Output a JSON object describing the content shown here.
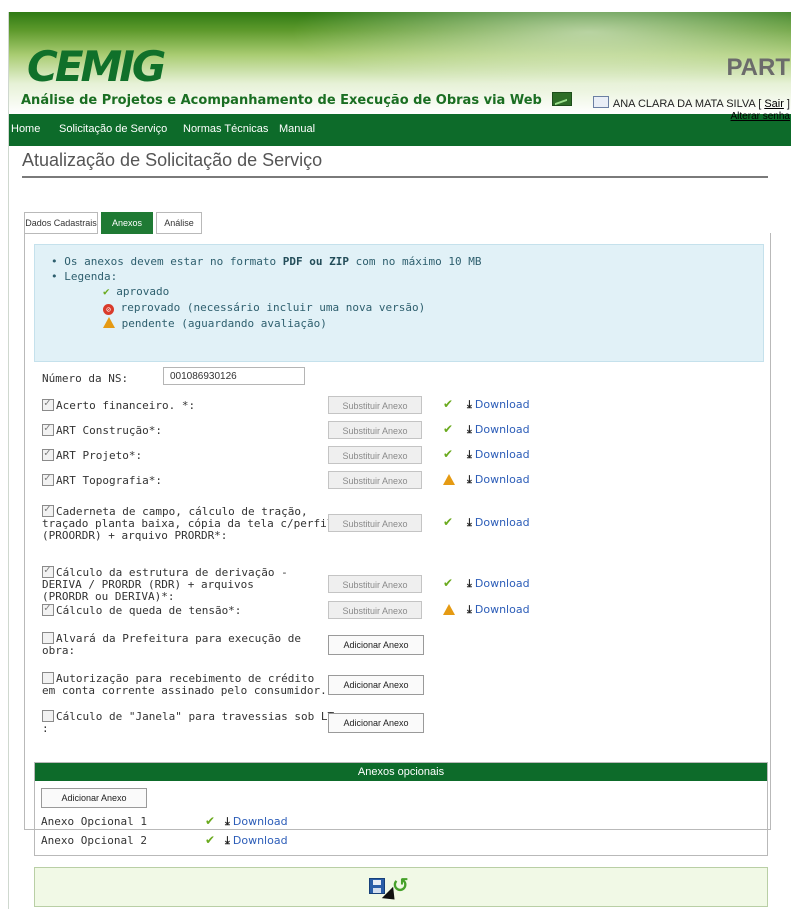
{
  "header": {
    "logo": "CEMIG",
    "subtitle": "Análise de Projetos e Acompanhamento de Execução de Obras via Web",
    "app_code": "PART",
    "user_name": "ANA CLARA DA MATA SILVA",
    "logout_label": "Sair",
    "change_password_label": "Alterar senha"
  },
  "nav": [
    "Home",
    "Solicitação de Serviço",
    "Normas Técnicas",
    "Manual"
  ],
  "page_title": "Atualização de Solicitação de Serviço",
  "tabs": [
    "Dados Cadastrais",
    "Anexos",
    "Análise"
  ],
  "active_tab": "Anexos",
  "info": {
    "line1_prefix": "Os anexos devem estar no formato",
    "line1_format": "PDF ou ZIP",
    "line1_suffix": "com no máximo 10 MB",
    "legend_label": "Legenda:",
    "approved": "aprovado",
    "rejected": "reprovado (necessário incluir uma nova versão)",
    "pending": "pendente (aguardando avaliação)"
  },
  "ns": {
    "label": "Número da NS:",
    "value": "001086930126"
  },
  "buttons": {
    "replace": "Substituir Anexo",
    "add": "Adicionar Anexo"
  },
  "download_label": "Download",
  "attachments": [
    {
      "label": "Acerto financeiro. *:",
      "checked": true,
      "status": "approved"
    },
    {
      "label": "ART Construção*:",
      "checked": true,
      "status": "approved"
    },
    {
      "label": "ART Projeto*:",
      "checked": true,
      "status": "approved"
    },
    {
      "label": "ART Topografia*:",
      "checked": true,
      "status": "pending"
    },
    {
      "label_lines": [
        "Caderneta de campo, cálculo de tração,",
        "traçado planta baixa, cópia da tela c/perfil",
        "(PROORDR) + arquivo PRORDR*:"
      ],
      "checked": true,
      "status": "approved"
    },
    {
      "label_lines": [
        "Cálculo da estrutura de derivação -",
        "DERIVA / PRORDR (RDR) + arquivos",
        "(PRORDR ou DERIVA)*:"
      ],
      "checked": true,
      "status": "approved"
    },
    {
      "label": "Cálculo de queda de tensão*:",
      "checked": true,
      "status": "pending"
    },
    {
      "label_lines": [
        "Alvará da Prefeitura para execução de",
        "obra:"
      ],
      "checked": false,
      "status": "none"
    },
    {
      "label_lines": [
        "Autorização para recebimento de crédito",
        "em conta corrente assinado pelo consumidor. :"
      ],
      "checked": false,
      "status": "none"
    },
    {
      "label_lines": [
        "Cálculo de \"Janela\" para travessias sob LT",
        ":"
      ],
      "checked": false,
      "status": "none"
    }
  ],
  "optional": {
    "title": "Anexos opcionais",
    "add_label": "Adicionar Anexo",
    "items": [
      {
        "label": "Anexo Opcional 1",
        "status": "approved"
      },
      {
        "label": "Anexo Opcional 2",
        "status": "approved"
      }
    ]
  },
  "colors": {
    "primary_green": "#0d6b2a",
    "approved": "#6aaa1e",
    "pending": "#e59a13",
    "rejected": "#d93b2b",
    "link": "#2c5db8"
  },
  "icons": {
    "save": "save-icon",
    "undo": "undo-icon",
    "download": "download-icon"
  }
}
